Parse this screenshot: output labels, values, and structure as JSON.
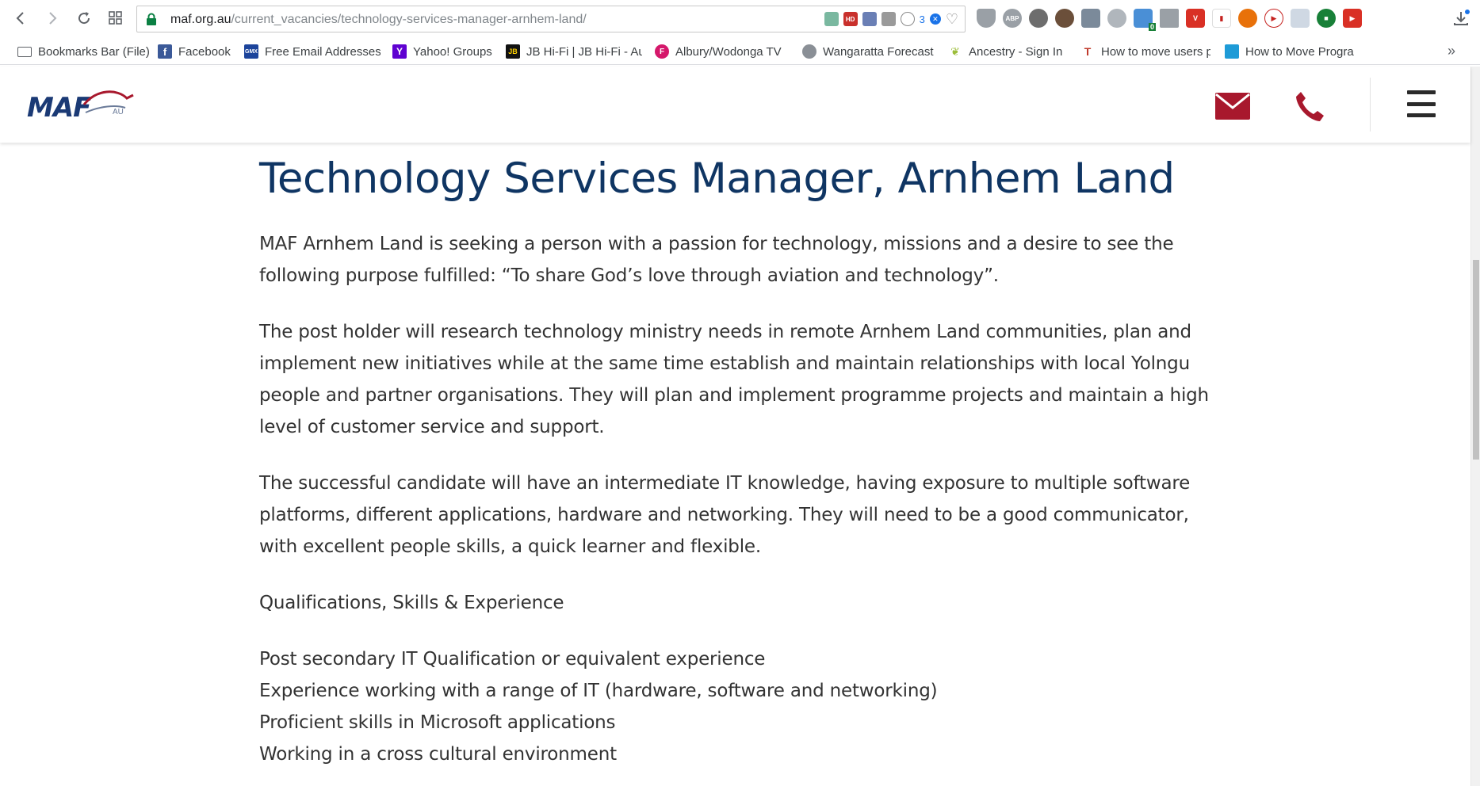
{
  "browser": {
    "url_host": "maf.org.au",
    "url_path": "/current_vacancies/technology-services-manager-arnhem-land/",
    "omnibox_badge_count": "3",
    "extension_badge": "0",
    "bookmarks": [
      {
        "label": "Bookmarks Bar (File)",
        "icon": "folder-icon",
        "color": "#5f6368"
      },
      {
        "label": "Facebook",
        "icon": "facebook-icon",
        "color": "#3b5998"
      },
      {
        "label": "Free Email Addresses",
        "icon": "gmx-icon",
        "color": "#1c449b"
      },
      {
        "label": "Yahoo! Groups",
        "icon": "yahoo-icon",
        "color": "#5f01d1"
      },
      {
        "label": "JB Hi-Fi | JB Hi-Fi - Au",
        "icon": "jbhifi-icon",
        "color": "#111111"
      },
      {
        "label": "Albury/Wodonga TV",
        "icon": "foxtel-icon",
        "color": "#d5186b"
      },
      {
        "label": "Wangaratta Forecast",
        "icon": "weather-icon",
        "color": "#8a8f96"
      },
      {
        "label": "Ancestry - Sign In",
        "icon": "ancestry-icon",
        "color": "#9cbd3a"
      },
      {
        "label": "How to move users p",
        "icon": "tenforums-icon",
        "color": "#c0392b"
      },
      {
        "label": "How to Move Progra",
        "icon": "howto-icon",
        "color": "#1e9bd7"
      }
    ],
    "more_bookmarks_glyph": "»"
  },
  "site": {
    "logo_text": "MAF",
    "logo_suffix": "AU",
    "brand_color": "#a8182d"
  },
  "page": {
    "title": "Technology Services Manager, Arnhem Land",
    "paragraphs": [
      "MAF Arnhem Land is seeking a person with a passion for technology, missions and a desire to see the following purpose fulfilled: “To share God’s love through aviation and technology”.",
      "The post holder will research technology ministry needs in remote Arnhem Land communities, plan and implement new initiatives while at the same time establish and maintain relationships with local Yolngu people and partner organisations. They will plan and implement programme projects and maintain a high level of customer service and support.",
      "The successful candidate will have an intermediate IT knowledge, having exposure to multiple software platforms, different applications, hardware and networking. They will need to be a good communicator, with excellent people skills, a quick learner and flexible.",
      "Qualifications, Skills & Experience"
    ],
    "requirements": [
      "Post secondary IT Qualification or equivalent experience",
      "Experience working with a range of IT (hardware, software and networking)",
      "Proficient skills in Microsoft applications",
      "Working in a cross cultural environment"
    ]
  }
}
